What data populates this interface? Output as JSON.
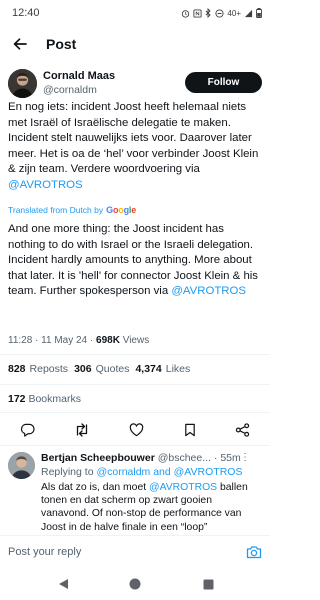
{
  "status_bar": {
    "time": "12:40",
    "battery_text": "40+"
  },
  "header": {
    "title": "Post"
  },
  "author": {
    "name": "Cornald Maas",
    "handle": "@cornaldm"
  },
  "follow_label": "Follow",
  "tweet": {
    "original_text": "En nog iets: incident Joost heeft helemaal niets met Israël of Israëlische delegatie te maken. Incident stelt nauwelijks iets voor. Daarover later meer. Het is oa de ‘hel’ voor verbinder Joost Klein & zijn team. Verdere woordvoering via ",
    "original_mention": "@AVROTROS",
    "translated_label": "Translated from Dutch by",
    "translated_by": "Google",
    "translation_text": "And one more thing: the Joost incident has nothing to do with Israel or the Israeli delegation. Incident hardly amounts to anything. More about that later. It is 'hell' for connector Joost Klein & his team. Further spokesperson via ",
    "translation_mention": "@AVROTROS",
    "time": "11:28 · 11 May 24 · ",
    "views": "698K",
    "views_label": " Views"
  },
  "stats": {
    "reposts": "828",
    "reposts_label": "Reposts",
    "quotes": "306",
    "quotes_label": "Quotes",
    "likes": "4,374",
    "likes_label": "Likes",
    "bookmarks": "172",
    "bookmarks_label": "Bookmarks"
  },
  "reply": {
    "name": "Bertjan Scheepbouwer",
    "handle": "@bschee...",
    "time": "· 55m",
    "replying_prefix": "Replying to ",
    "replying_mentions": "@cornaldm and @AVROTROS",
    "text_before": "Als dat zo is, dan moet ",
    "text_mention": "@AVROTROS",
    "text_after": " ballen tonen en dat scherm op zwart gooien vanavond. Of non-stop de performance van Joost in de halve finale in een “loop”"
  },
  "composer": {
    "placeholder": "Post your reply"
  },
  "colors": {
    "accent": "#1d9bf0",
    "text": "#0f1419",
    "secondary": "#536471"
  },
  "icons": [
    "back-arrow-icon",
    "reply-icon",
    "repost-icon",
    "like-icon",
    "bookmark-icon",
    "share-icon",
    "camera-icon",
    "nav-back-icon",
    "nav-home-icon",
    "nav-recents-icon"
  ]
}
